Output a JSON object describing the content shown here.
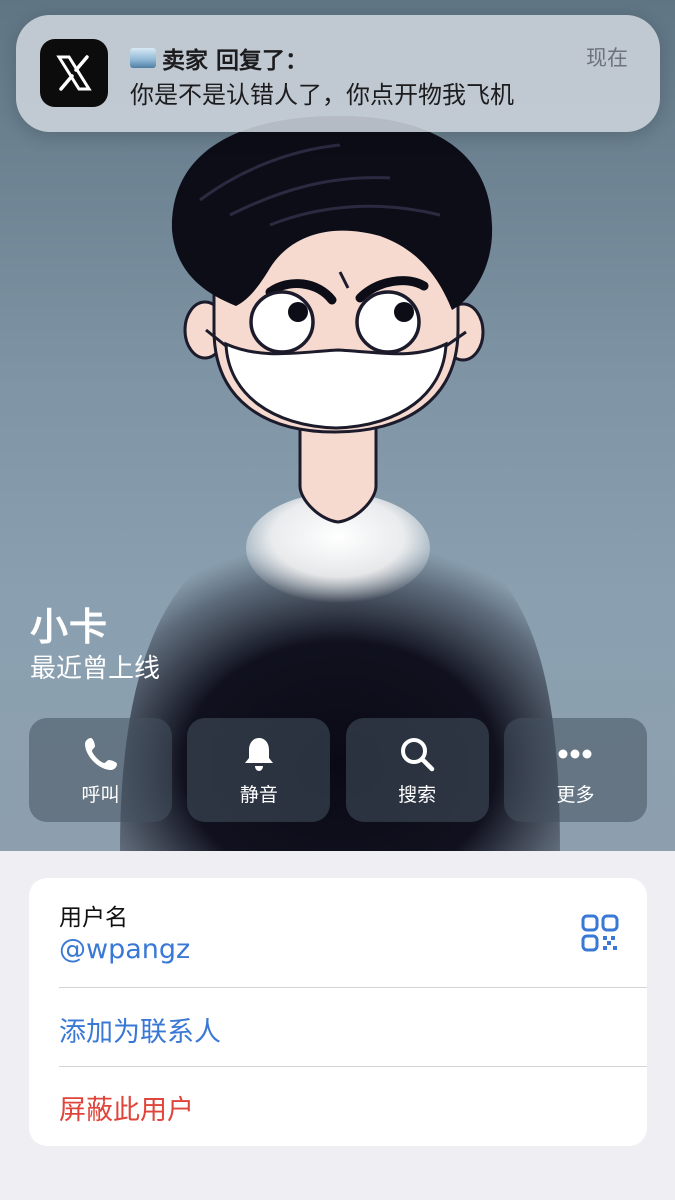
{
  "notification": {
    "app_icon": "x-logo-icon",
    "emoji_icon": "ice-cube-emoji",
    "title": "卖家 回复了：",
    "message": "你是不是认错人了，你点开物我飞机",
    "time": "现在"
  },
  "profile": {
    "name": "小卡",
    "status": "最近曾上线"
  },
  "actions": [
    {
      "label": "呼叫",
      "icon": "phone-icon"
    },
    {
      "label": "静音",
      "icon": "bell-icon"
    },
    {
      "label": "搜索",
      "icon": "search-icon"
    },
    {
      "label": "更多",
      "icon": "more-icon"
    }
  ],
  "info": {
    "username_label": "用户名",
    "username": "@wpangz",
    "qr_icon": "qr-code-icon",
    "add_contact": "添加为联系人",
    "block_user": "屏蔽此用户"
  },
  "colors": {
    "accent": "#3a78d6",
    "danger": "#e0453c",
    "background": "#eeeef3"
  }
}
